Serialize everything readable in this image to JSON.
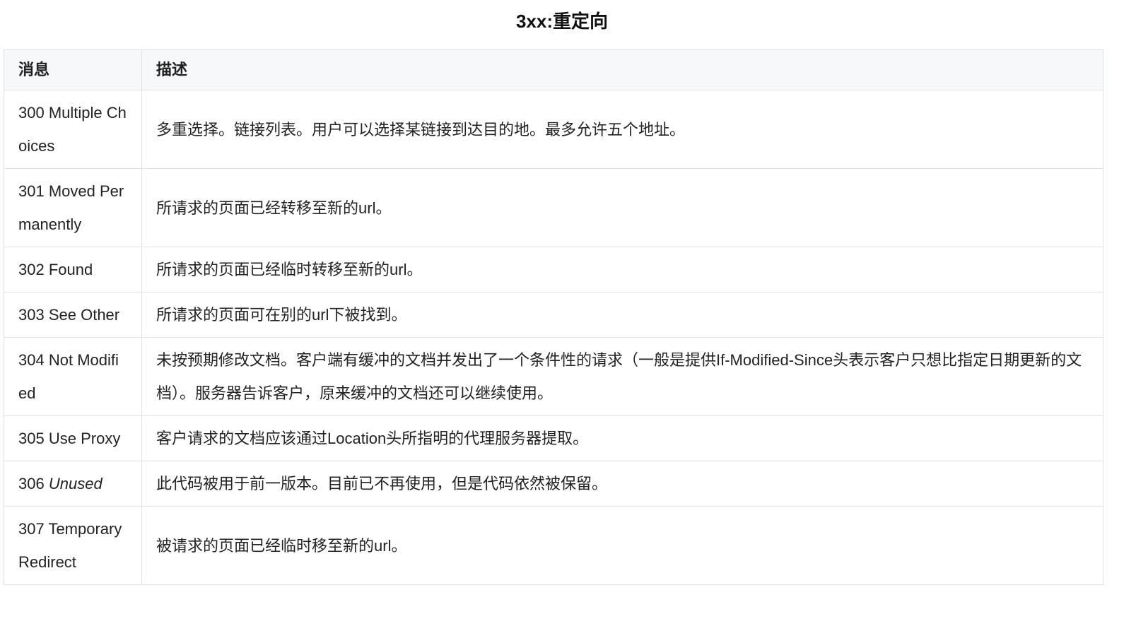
{
  "title": "3xx:重定向",
  "table": {
    "headers": {
      "message": "消息",
      "description": "描述"
    },
    "rows": [
      {
        "code": "300",
        "message": "Multiple Choices",
        "description": "多重选择。链接列表。用户可以选择某链接到达目的地。最多允许五个地址。"
      },
      {
        "code": "301",
        "message": "Moved Permanently",
        "description": "所请求的页面已经转移至新的url。"
      },
      {
        "code": "302",
        "message": "Found",
        "description": "所请求的页面已经临时转移至新的url。"
      },
      {
        "code": "303",
        "message": "See Other",
        "description": "所请求的页面可在别的url下被找到。"
      },
      {
        "code": "304",
        "message": "Not Modified",
        "description": "未按预期修改文档。客户端有缓冲的文档并发出了一个条件性的请求（一般是提供If-Modified-Since头表示客户只想比指定日期更新的文档）。服务器告诉客户，原来缓冲的文档还可以继续使用。"
      },
      {
        "code": "305",
        "message": "Use Proxy",
        "description": "客户请求的文档应该通过Location头所指明的代理服务器提取。"
      },
      {
        "code": "306",
        "message": "Unused",
        "italic": true,
        "description": "此代码被用于前一版本。目前已不再使用，但是代码依然被保留。"
      },
      {
        "code": "307",
        "message": "Temporary Redirect",
        "description": "被请求的页面已经临时移至新的url。"
      }
    ]
  }
}
